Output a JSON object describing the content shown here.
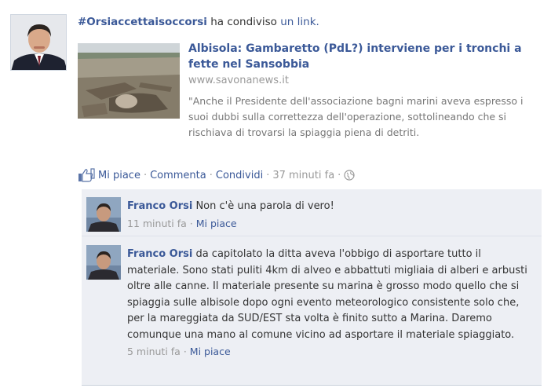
{
  "story": {
    "actor": "#Orsiaccettaisoccorsi",
    "verb": "ha condiviso",
    "object": "un link."
  },
  "attachment": {
    "title": "Albisola: Gambaretto (PdL?) interviene per i tronchi a fette nel Sansobbia",
    "url": "www.savonanews.it",
    "description": "\"Anche il Presidente dell'associazione bagni marini aveva espresso i suoi dubbi sulla correttezza dell'operazione, sottolineando che si rischiava di trovarsi la spiaggia piena di detriti."
  },
  "actions": {
    "like": "Mi piace",
    "comment": "Commenta",
    "share": "Condividi",
    "time": "37 minuti fa",
    "separator": "·",
    "privacy_icon": "globe-icon",
    "like_icon": "thumbs-up-icon"
  },
  "comments": [
    {
      "author": "Franco Orsi",
      "text": "Non c'è una parola di vero!",
      "time": "11 minuti fa",
      "like": "Mi piace"
    },
    {
      "author": "Franco Orsi",
      "text": "da capitolato la ditta aveva l'obbigo di asportare tutto il materiale. Sono stati puliti 4km di alveo e abbattuti migliaia di alberi e arbusti oltre alle canne. Il materiale presente su marina è grosso modo quello che si spiaggia sulle albisole dopo ogni evento meteorologico consistente solo che, per la mareggiata da SUD/EST sta volta è finito sutto a Marina. Daremo comunque una mano al comune vicino ad asportare il materiale spiaggiato.",
      "time": "5 minuti fa",
      "like": "Mi piace"
    }
  ],
  "colors": {
    "link": "#3b5998",
    "muted": "#999999",
    "comment_bg": "#edeff4"
  }
}
